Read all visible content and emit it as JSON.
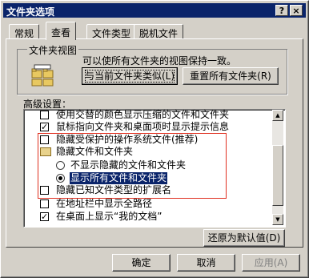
{
  "window": {
    "title": "文件夹选项",
    "help_glyph": "?",
    "close_glyph": "×"
  },
  "tabs": [
    {
      "label": "常规",
      "active": false
    },
    {
      "label": "查看",
      "active": true
    },
    {
      "label": "文件类型",
      "active": false
    },
    {
      "label": "脱机文件",
      "active": false
    }
  ],
  "folder_views": {
    "title": "文件夹视图",
    "description": "可以使所有文件夹的视图保持一致。",
    "apply_button": "与当前文件夹类似(L)",
    "reset_button": "重置所有文件夹(R)"
  },
  "advanced": {
    "label": "高级设置：",
    "items": [
      {
        "label": "使用交替的颜色显示压缩的文件和文件夹",
        "kind": "checkbox",
        "checked": false
      },
      {
        "label": "鼠标指向文件夹和桌面项时显示提示信息",
        "kind": "checkbox",
        "checked": true
      },
      {
        "label": "隐藏受保护的操作系统文件(推荐)",
        "kind": "checkbox",
        "checked": false
      },
      {
        "label": "隐藏文件和文件夹",
        "kind": "folder"
      },
      {
        "label": "不显示隐藏的文件和文件夹",
        "kind": "radio",
        "checked": false
      },
      {
        "label": "显示所有文件和文件夹",
        "kind": "radio",
        "checked": true,
        "selected": true
      },
      {
        "label": "隐藏已知文件类型的扩展名",
        "kind": "checkbox",
        "checked": false
      },
      {
        "label": "在地址栏中显示全路径",
        "kind": "checkbox",
        "checked": false
      },
      {
        "label": "在桌面上显示“我的文档”",
        "kind": "checkbox",
        "checked": true
      }
    ],
    "check_glyph": "✓",
    "scroll_up_glyph": "▲",
    "scroll_down_glyph": "▼"
  },
  "restore_button": "还原为默认值(D)",
  "footer": {
    "ok": "确定",
    "cancel": "取消",
    "apply": "应用(A)"
  },
  "colors": {
    "titlebar": "#0a246a",
    "face": "#d4d0c8",
    "selection": "#0a246a",
    "highlight_box": "#e03020"
  }
}
